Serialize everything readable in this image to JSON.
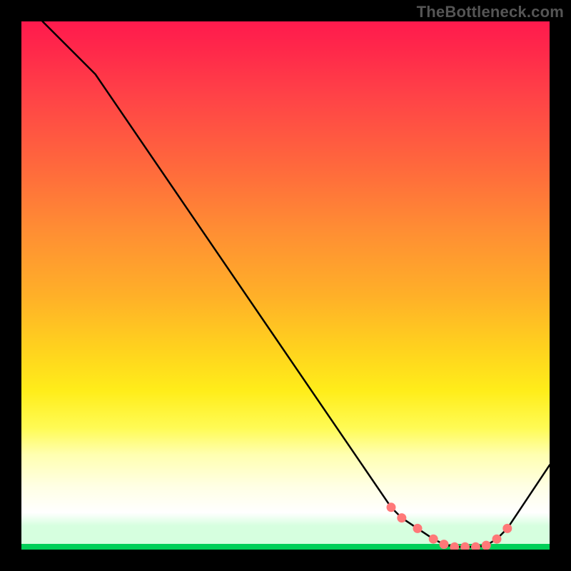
{
  "attribution": "TheBottleneck.com",
  "chart_data": {
    "type": "line",
    "title": "",
    "xlabel": "",
    "ylabel": "",
    "xlim": [
      0,
      100
    ],
    "ylim": [
      0,
      100
    ],
    "series": [
      {
        "name": "curve",
        "x": [
          4,
          11,
          14,
          70,
          72,
          75,
          78,
          80,
          82,
          84,
          86,
          88,
          90,
          92,
          100
        ],
        "y": [
          100,
          93,
          90,
          8,
          6,
          4,
          2,
          1,
          0.5,
          0.5,
          0.5,
          0.8,
          2,
          4,
          16
        ]
      }
    ],
    "marker_points": {
      "x": [
        70,
        72,
        75,
        78,
        80,
        82,
        84,
        86,
        88,
        90,
        92
      ],
      "y": [
        8,
        6,
        4,
        2,
        1,
        0.5,
        0.5,
        0.5,
        0.8,
        2,
        4
      ]
    },
    "gradient": {
      "top_color": "#ff1a4d",
      "mid_color": "#ffed1a",
      "band_color": "#d6ffdf",
      "bottom_color": "#00e060"
    }
  }
}
